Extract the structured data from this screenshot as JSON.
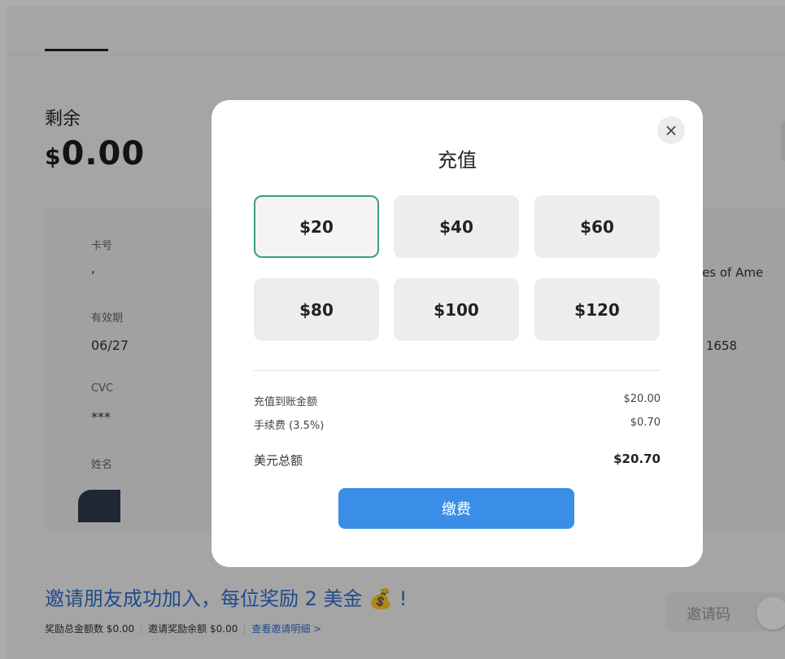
{
  "balance": {
    "label": "剩余",
    "currency": "$",
    "amount": "0.00"
  },
  "card": {
    "number_label": "卡号",
    "number_value": ",",
    "expiry_label": "有效期",
    "expiry_value": "06/27",
    "cvc_label": "CVC",
    "cvc_value": "***",
    "name_label": "姓名",
    "country_partial": "ates of Ame",
    "address_partial": "et 1658"
  },
  "invite": {
    "title": "邀请朋友成功加入，每位奖励 2 美金",
    "emoji": "💰",
    "exclaim": "!",
    "total_reward": "奖励总金额数 $0.00",
    "reward_balance": "邀请奖励余额 $0.00",
    "details_link": "查看邀请明细 >",
    "code_label": "邀请码"
  },
  "modal": {
    "title": "充值",
    "close_icon": "×",
    "options": [
      "$20",
      "$40",
      "$60",
      "$80",
      "$100",
      "$120"
    ],
    "selected_index": 0,
    "summary": {
      "deposit_label": "充值到账金额",
      "deposit_value": "$20.00",
      "fee_label": "手续费 (3.5%)",
      "fee_value": "$0.70",
      "total_label": "美元总额",
      "total_value": "$20.70"
    },
    "pay_label": "缴费"
  },
  "colors": {
    "accent": "#3a8ee8",
    "selected_border": "#3aa176",
    "link": "#2f6fd0"
  }
}
